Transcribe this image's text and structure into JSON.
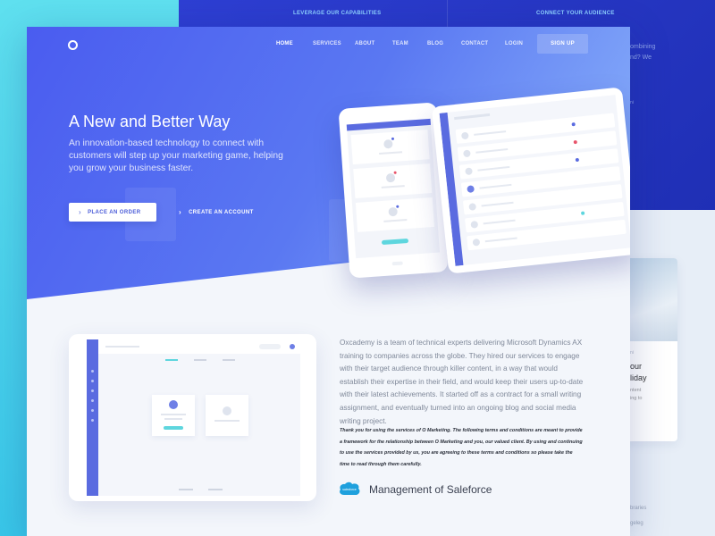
{
  "background": {
    "top_left_text": "LEVERAGE OUR CAPABILITIES",
    "top_right_text": "CONNECT YOUR AUDIENCE",
    "peek_line1": "ombining",
    "peek_line2": "nd? We",
    "peek_small": "ni",
    "card_title_line1": "our",
    "card_title_line2": "liday",
    "card_sub_line1": "ntent",
    "card_sub_line2": "ing to",
    "bottom_peek1": "braries",
    "bottom_peek2": "geleg"
  },
  "nav": {
    "items": [
      "HOME",
      "SERVICES",
      "ABOUT",
      "TEAM",
      "BLOG",
      "CONTACT",
      "LOGIN"
    ],
    "signup_label": "SIGN UP",
    "active_item": "HOME"
  },
  "hero": {
    "title": "A New and Better Way",
    "subtitle": "An innovation-based technology to connect with customers will step up your marketing game, helping you grow your business faster.",
    "primary_button": "PLACE AN ORDER",
    "secondary_button": "CREATE AN ACCOUNT"
  },
  "about": {
    "body": "Oxcademy is a team of technical experts delivering Microsoft Dynamics AX training to companies across the globe. They hired our services to engage with their target audience through killer content, in a way that would establish their expertise in their field, and would keep their users up-to-date with their latest achievements. It started off as a contract for a small writing assignment, and eventually turned into an ongoing blog and social media writing project.",
    "terms": "Thank you for using the services of  O Marketing. The following terms and conditions are meant to provide a framework for the relationship between O Marketing and you, our valued client. By using and continuing to use the services provided by us, you are agreeing to these terms and conditions so please take the time to read through them carefully.",
    "salesforce_logo_text": "salesforce",
    "section_title": "Management of Saleforce"
  },
  "colors": {
    "hero_start": "#4a5cf0",
    "hero_end": "#8fb7fb",
    "accent_blue": "#5a6be0",
    "teal": "#5ed6de",
    "bg_left": "#3fd0ec",
    "bg_top": "#2436c4"
  }
}
